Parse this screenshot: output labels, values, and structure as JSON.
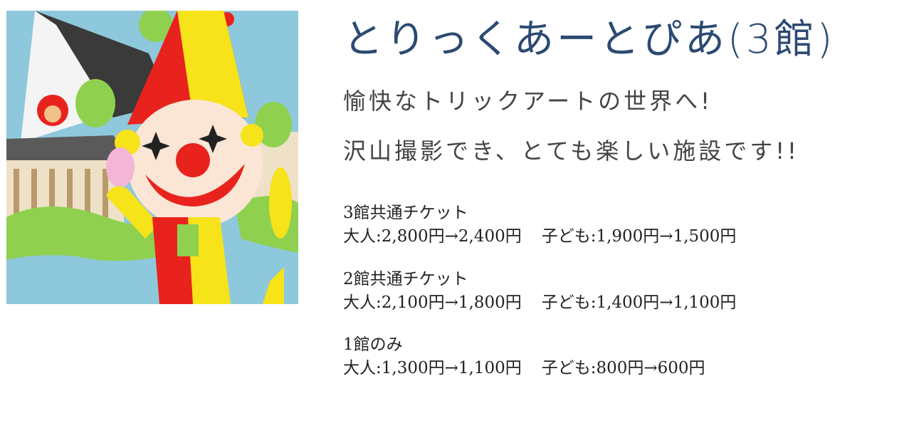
{
  "title": "とりっくあーとぴあ(3館)",
  "tagline": [
    "愉快なトリックアートの世界へ!",
    "沢山撮影でき、とても楽しい施設です!!"
  ],
  "tickets": [
    {
      "name": "3館共通チケット",
      "adult": "大人:2,800円→2,400円",
      "child": "子ども:1,900円→1,500円"
    },
    {
      "name": "2館共通チケット",
      "adult": "大人:2,100円→1,800円",
      "child": "子ども:1,400円→1,100円"
    },
    {
      "name": "1館のみ",
      "adult": "大人:1,300円→1,100円",
      "child": "子ども:800円→600円"
    }
  ],
  "colors": {
    "title": "#2c4a72",
    "sky": "#8ec8dc",
    "clown_red": "#e8231d",
    "clown_yellow": "#f6e31a",
    "grass": "#8fd14f"
  }
}
